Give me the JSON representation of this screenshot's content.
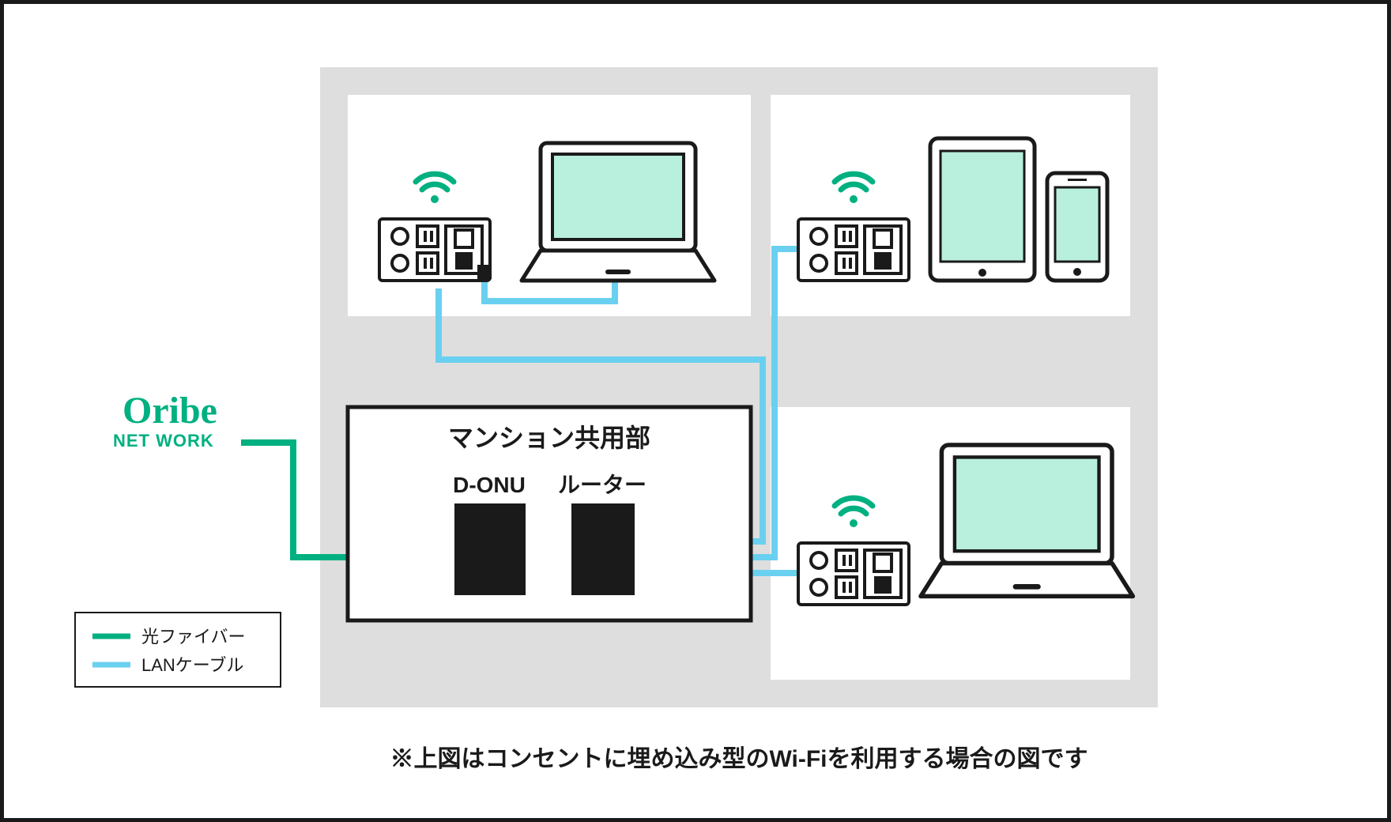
{
  "logo": {
    "brand": "Oribe",
    "sub": "NET WORK"
  },
  "legend": {
    "fiber": "光ファイバー",
    "lan": "LANケーブル"
  },
  "shared": {
    "title": "マンション共用部",
    "donu": "D-ONU",
    "router": "ルーター"
  },
  "footnote": "※上図はコンセントに埋め込み型のWi-Fiを利用する場合の図です",
  "colors": {
    "accent": "#00b080",
    "lan": "#6ad0f0",
    "screen": "#b8f0dd"
  }
}
